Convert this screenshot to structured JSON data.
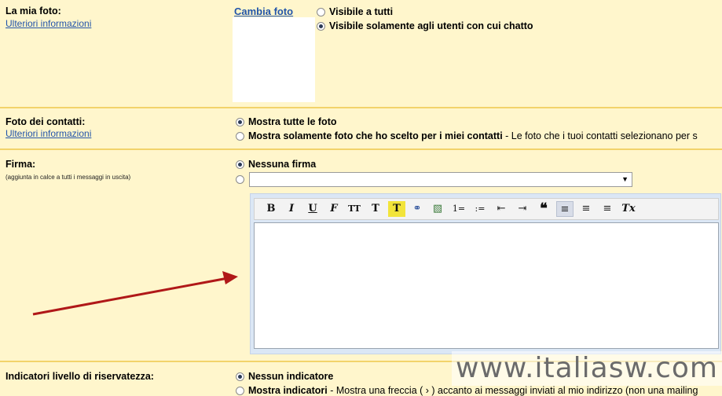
{
  "photo_section": {
    "label": "La mia foto:",
    "more_link": "Ulteriori informazioni",
    "change_link": "Cambia foto",
    "options": [
      {
        "label": "Visibile a tutti",
        "selected": false
      },
      {
        "label": "Visibile solamente agli utenti con cui chatto",
        "selected": true
      }
    ]
  },
  "contacts_section": {
    "label": "Foto dei contatti:",
    "more_link": "Ulteriori informazioni",
    "options": [
      {
        "label": "Mostra tutte le foto",
        "selected": true
      },
      {
        "label": "Mostra solamente foto che ho scelto per i miei contatti",
        "suffix": " - Le foto che i tuoi contatti selezionano per s",
        "selected": false
      }
    ]
  },
  "signature_section": {
    "label": "Firma:",
    "note": "(aggiunta in calce a tutti i messaggi in uscita)",
    "options": [
      {
        "label": "Nessuna firma",
        "selected": true
      }
    ],
    "toolbar": [
      "B",
      "I",
      "U",
      "F",
      "TT",
      "T",
      "T",
      "link",
      "image",
      "1=",
      ":=",
      "outdent",
      "indent",
      "quote",
      "left",
      "center",
      "right",
      "Tx"
    ]
  },
  "privacy_section": {
    "label": "Indicatori livello di riservatezza:",
    "options": [
      {
        "label": "Nessun indicatore",
        "selected": true
      },
      {
        "label": "Mostra indicatori",
        "suffix": " - Mostra una freccia ( › ) accanto ai messaggi inviati al mio indirizzo (non una mailing",
        "selected": false
      }
    ]
  },
  "watermark": "www.italiasw.com",
  "colors": {
    "background": "#fff6cc",
    "separator": "#f2d36b",
    "link": "#2255aa",
    "arrow": "#b01818"
  }
}
